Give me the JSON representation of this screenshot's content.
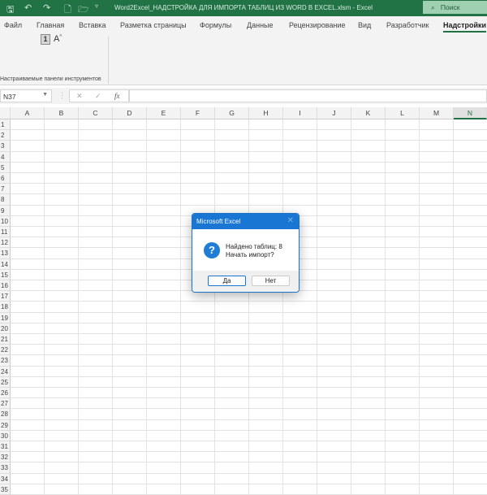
{
  "titlebar": {
    "title": "Word2Excel_НАДСТРОЙКА ДЛЯ ИМПОРТА ТАБЛИЦ ИЗ WORD В EXCEL.xlsm  -  Excel",
    "search": "Поиск"
  },
  "tabs": [
    "Файл",
    "Главная",
    "Вставка",
    "Разметка страницы",
    "Формулы",
    "Данные",
    "Рецензирование",
    "Вид",
    "Разработчик",
    "Надстройки"
  ],
  "ribbon": {
    "button1": "1",
    "button2": "A",
    "group_label": "Настраиваемые панели инструментов"
  },
  "formula_bar": {
    "name_box": "N37",
    "fx": "fx",
    "value": ""
  },
  "grid": {
    "columns": [
      "A",
      "B",
      "C",
      "D",
      "E",
      "F",
      "G",
      "H",
      "I",
      "J",
      "K",
      "L",
      "M",
      "N"
    ],
    "selected_column": "N",
    "rows": [
      "1",
      "2",
      "3",
      "4",
      "5",
      "6",
      "7",
      "8",
      "9",
      "10",
      "11",
      "12",
      "13",
      "14",
      "15",
      "16",
      "17",
      "18",
      "19",
      "20",
      "21",
      "22",
      "23",
      "24",
      "25",
      "26",
      "27",
      "28",
      "29",
      "30",
      "31",
      "32",
      "33",
      "34",
      "35"
    ]
  },
  "dialog": {
    "title": "Microsoft Excel",
    "line1": "Найдено таблиц: 8",
    "line2": "Начать импорт?",
    "yes": "Да",
    "no": "Нет"
  }
}
